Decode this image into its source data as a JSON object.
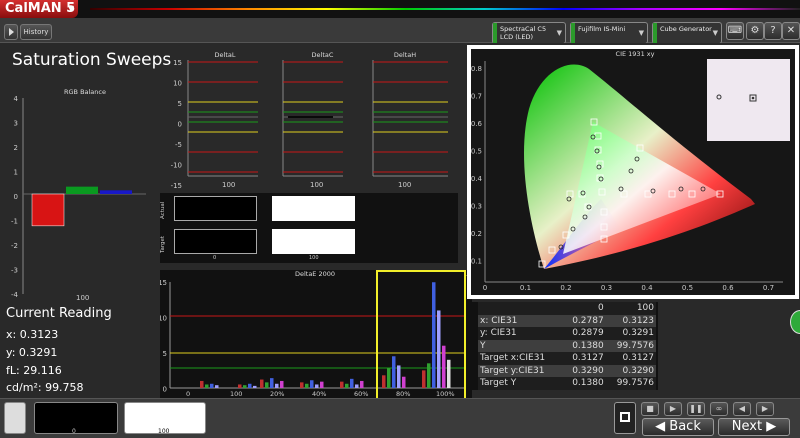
{
  "app": {
    "logo": "CalMAN 5",
    "tab": "History 1"
  },
  "devices": [
    {
      "line1": "SpectraCal C5",
      "line2": "LCD (LED)"
    },
    {
      "line1": "Fujifilm IS-Mini",
      "line2": ""
    },
    {
      "line1": "Cube Generator",
      "line2": ""
    }
  ],
  "toolbar_icons": [
    "keyboard-icon",
    "settings-icon",
    "help-icon",
    "close-icon"
  ],
  "page": {
    "title": "Saturation Sweeps"
  },
  "rgb_balance": {
    "title": "RGB Balance",
    "yticks": [
      "4",
      "3",
      "2",
      "1",
      "0",
      "-1",
      "-2",
      "-3",
      "-4"
    ],
    "xlabel": "100",
    "values": {
      "red": -1.3,
      "green": 0.3,
      "blue": 0.15
    }
  },
  "delta_charts": [
    {
      "title": "DeltaL",
      "yticks": [
        "15",
        "10",
        "5",
        "0",
        "-5",
        "-10",
        "-15"
      ],
      "xlabel": "100"
    },
    {
      "title": "DeltaC",
      "xlabel": "100"
    },
    {
      "title": "DeltaH",
      "xlabel": "100"
    }
  ],
  "swatch_panel": {
    "row_labels": [
      "Actual",
      "Target"
    ],
    "col_labels": [
      "0",
      "100"
    ]
  },
  "deltae": {
    "title": "DeltaE 2000",
    "yticks": [
      "15",
      "10",
      "5",
      "0"
    ],
    "xticks": [
      "0",
      "100",
      "20%",
      "40%",
      "60%",
      "80%",
      "100%"
    ]
  },
  "current_reading": {
    "heading": "Current Reading",
    "x": "x: 0.3123",
    "y": "y: 0.3291",
    "fl": "fL: 29.116",
    "cdm2": "cd/m²: 99.758"
  },
  "cie": {
    "title": "CIE 1931 xy",
    "xticks": [
      "0",
      "0.1",
      "0.2",
      "0.3",
      "0.4",
      "0.5",
      "0.6",
      "0.7"
    ],
    "yticks": [
      "0.8",
      "0.7",
      "0.6",
      "0.5",
      "0.4",
      "0.3",
      "0.2",
      "0.1"
    ]
  },
  "cie_table": {
    "headers": [
      "",
      "0",
      "100"
    ],
    "rows": [
      [
        "x: CIE31",
        "0.2787",
        "0.3123"
      ],
      [
        "y: CIE31",
        "0.2879",
        "0.3291"
      ],
      [
        "Y",
        "0.1380",
        "99.7576"
      ],
      [
        "Target x:CIE31",
        "0.3127",
        "0.3127"
      ],
      [
        "Target y:CIE31",
        "0.3290",
        "0.3290"
      ],
      [
        "Target Y",
        "0.1380",
        "99.7576"
      ]
    ]
  },
  "bottom": {
    "swatch_labels": [
      "0",
      "100"
    ],
    "back": "Back",
    "next": "Next"
  },
  "colors": {
    "accent_red": "#c41a1a",
    "highlight": "#f2ee2a"
  }
}
